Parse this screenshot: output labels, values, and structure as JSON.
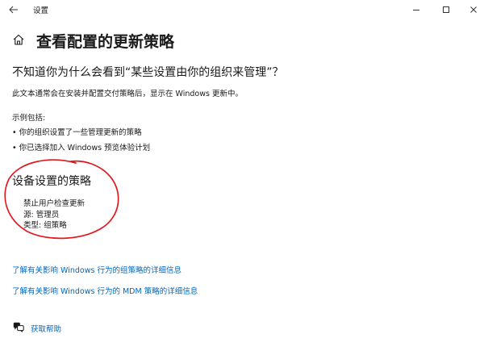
{
  "window": {
    "app_title": "设置"
  },
  "page": {
    "title": "查看配置的更新策略"
  },
  "info": {
    "question": "不知道你为什么会看到“某些设置由你的组织来管理”？",
    "description": "此文本通常会在安装并配置交付策略后，显示在 Windows 更新中。",
    "examples_title": "示例包括:",
    "examples": [
      "• 你的组织设置了一些管理更新的策略",
      "• 你已选择加入 Windows 预览体验计划"
    ]
  },
  "policies": {
    "title": "设备设置的策略",
    "item": {
      "name": "禁止用户检查更新",
      "source": "源: 管理员",
      "type": "类型: 组策略"
    }
  },
  "links": [
    "了解有关影响 Windows 行为的组策略的详细信息",
    "了解有关影响 Windows 行为的 MDM 策略的详细信息"
  ],
  "help": {
    "label": "获取帮助"
  },
  "colors": {
    "accent_link": "#0067c0",
    "annotation_circle": "#e0191f"
  }
}
